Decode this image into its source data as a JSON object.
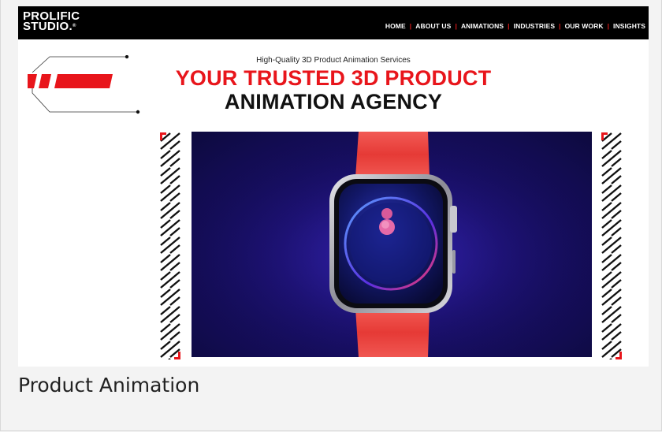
{
  "brand": {
    "logo_line1": "PROLIFIC",
    "logo_line2": "STUDIO.",
    "logo_mark": "®"
  },
  "nav": {
    "items": [
      "HOME",
      "ABOUT US",
      "ANIMATIONS",
      "INDUSTRIES",
      "OUR WORK",
      "INSIGHTS"
    ],
    "separator": "|"
  },
  "hero": {
    "subtitle": "High-Quality 3D Product Animation Services",
    "heading_line1": "YOUR TRUSTED 3D PRODUCT",
    "heading_line2": "ANIMATION AGENCY"
  },
  "media": {
    "subject": "smartwatch-render"
  },
  "caption": "Product Animation",
  "colors": {
    "accent_red": "#e8151b",
    "topbar": "#000000",
    "video_bg": "#1a0f6e",
    "watch_band": "#ef3f3c"
  },
  "icons": {
    "left_decor": "red-speed-bars-icon",
    "stripes": "diagonal-arrow-stripe"
  }
}
